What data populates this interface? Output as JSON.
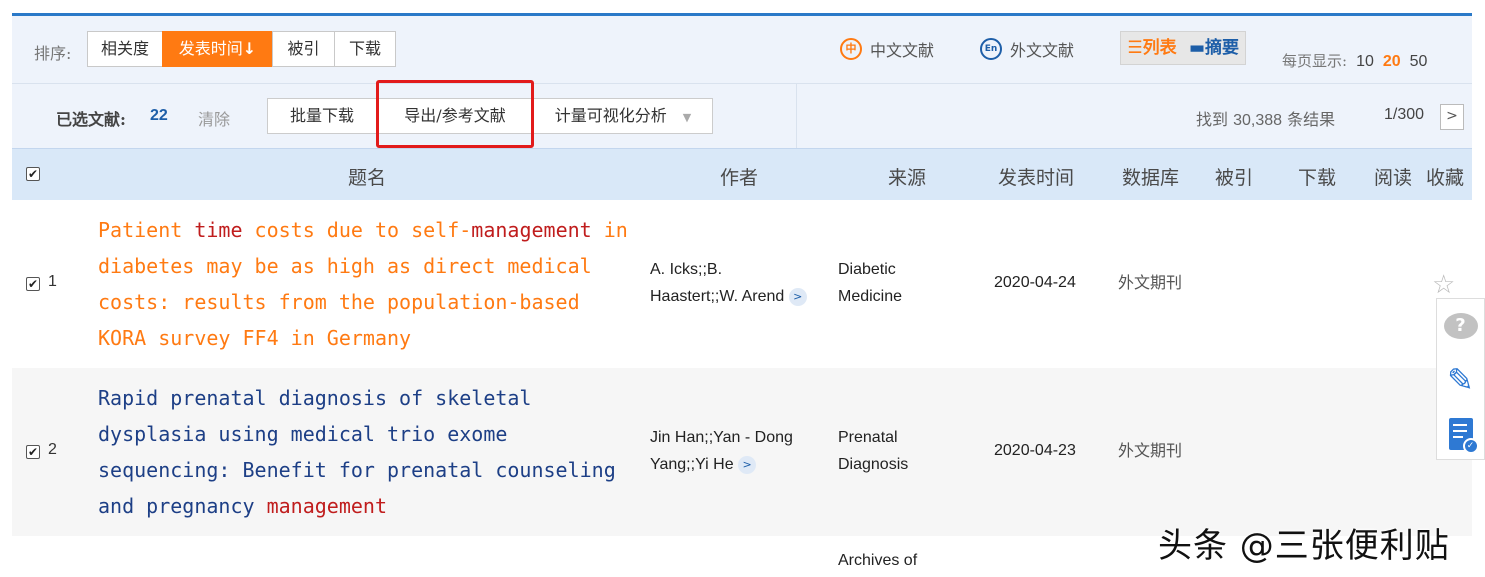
{
  "sort": {
    "label": "排序:",
    "options": [
      "相关度",
      "发表时间",
      "被引",
      "下载"
    ],
    "active_arrow": "↓"
  },
  "lang": {
    "zh": "中文文献",
    "zh_icon": "中",
    "en": "外文文献",
    "en_icon": "En"
  },
  "view": {
    "list": "☰列表",
    "abstract": "▬摘要"
  },
  "per_page": {
    "label": "每页显示:",
    "options": [
      "10",
      "20",
      "50"
    ],
    "active": "20"
  },
  "actions": {
    "selected_label": "已选文献:",
    "selected_count": "22",
    "clear": "清除",
    "batch_download": "批量下载",
    "export": "导出/参考文献",
    "analysis": "计量可视化分析",
    "analysis_caret": "▼"
  },
  "results": {
    "found_prefix": "找到",
    "count": "30,388",
    "found_suffix": "条结果",
    "page": "1/300",
    "next": ">"
  },
  "table": {
    "headers": {
      "title": "题名",
      "author": "作者",
      "source": "来源",
      "date": "发表时间",
      "db": "数据库",
      "cited": "被引",
      "download": "下载",
      "read": "阅读",
      "fav": "收藏"
    },
    "rows": [
      {
        "index": "1",
        "checked": "✔",
        "title_lines": [
          [
            {
              "t": "Patient "
            },
            {
              "t": "time",
              "hl": true
            },
            {
              "t": " costs due to self‐"
            },
            {
              "t": "management",
              "hl": true
            },
            {
              "t": " in"
            }
          ],
          [
            {
              "t": "diabetes may be as high as direct medical"
            }
          ],
          [
            {
              "t": "costs: results from the population‐based"
            }
          ],
          [
            {
              "t": "KORA survey FF4 in Germany"
            }
          ]
        ],
        "author_line1": "A. Icks;;B.",
        "author_line2": "Haastert;;W. Arend",
        "source_line1": "Diabetic",
        "source_line2": "Medicine",
        "date": "2020-04-24",
        "db": "外文期刊",
        "fav_icon": "☆"
      },
      {
        "index": "2",
        "checked": "✔",
        "title_lines": [
          [
            {
              "t": "Rapid prenatal diagnosis of skeletal"
            }
          ],
          [
            {
              "t": "dysplasia using medical trio exome"
            }
          ],
          [
            {
              "t": "sequencing: Benefit for prenatal counseling"
            }
          ],
          [
            {
              "t": "and pregnancy "
            },
            {
              "t": "management",
              "hl": true
            }
          ]
        ],
        "author_line1": "Jin Han;;Yan - Dong",
        "author_line2": "Yang;;Yi He",
        "source_line1": "Prenatal",
        "source_line2": "Diagnosis",
        "date": "2020-04-23",
        "db": "外文期刊",
        "fav_icon": "☆"
      },
      {
        "source_line1": "Archives of"
      }
    ]
  },
  "float": {
    "help_icon": "?",
    "edit_icon": "✎",
    "check_icon": "✓"
  },
  "watermark": "头条 @三张便利贴",
  "colors": {
    "accent": "#ff7a12",
    "brand_blue": "#1d5ea8",
    "highlight_red": "#e21b1b",
    "keyword_red": "#c01d1d"
  }
}
